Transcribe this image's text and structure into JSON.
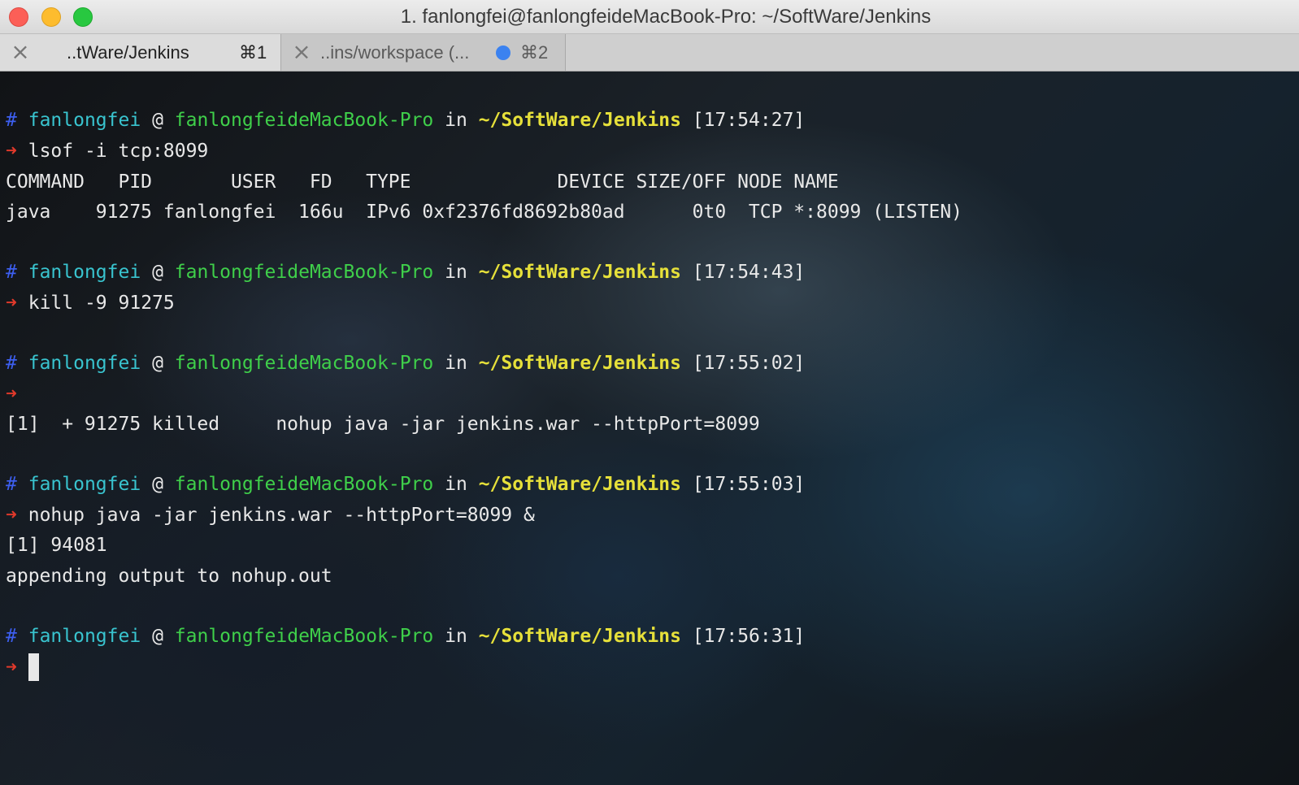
{
  "window": {
    "title": "1. fanlongfei@fanlongfeideMacBook-Pro: ~/SoftWare/Jenkins"
  },
  "tabs": [
    {
      "label": "..tWare/Jenkins",
      "shortcut": "⌘1",
      "close_icon": "close-icon"
    },
    {
      "label": "..ins/workspace (...",
      "shortcut": "⌘2",
      "close_icon": "close-icon",
      "activity_dot_color": "#3b82f0"
    }
  ],
  "colors": {
    "prompt_hash": "#3d5ff0",
    "prompt_user": "#39c4cf",
    "prompt_host": "#3fcf4a",
    "prompt_path": "#e6e03a",
    "prompt_arrow": "#e0392b",
    "text": "#e8e8e8"
  },
  "prompt": {
    "hash": "#",
    "user": "fanlongfei",
    "at": "@",
    "host": "fanlongfeideMacBook-Pro",
    "in": "in",
    "path": "~/SoftWare/Jenkins",
    "arrow": "➜"
  },
  "blocks": [
    {
      "time": "[17:54:27]",
      "command": "lsof -i tcp:8099",
      "output": [
        "COMMAND   PID       USER   FD   TYPE             DEVICE SIZE/OFF NODE NAME",
        "java    91275 fanlongfei  166u  IPv6 0xf2376fd8692b80ad      0t0  TCP *:8099 (LISTEN)"
      ]
    },
    {
      "time": "[17:54:43]",
      "command": "kill -9 91275",
      "output": []
    },
    {
      "time": "[17:55:02]",
      "command": "",
      "output": [
        "[1]  + 91275 killed     nohup java -jar jenkins.war --httpPort=8099"
      ]
    },
    {
      "time": "[17:55:03]",
      "command": "nohup java -jar jenkins.war --httpPort=8099 &",
      "output": [
        "[1] 94081",
        "appending output to nohup.out"
      ]
    },
    {
      "time": "[17:56:31]",
      "command": "",
      "output": []
    }
  ]
}
